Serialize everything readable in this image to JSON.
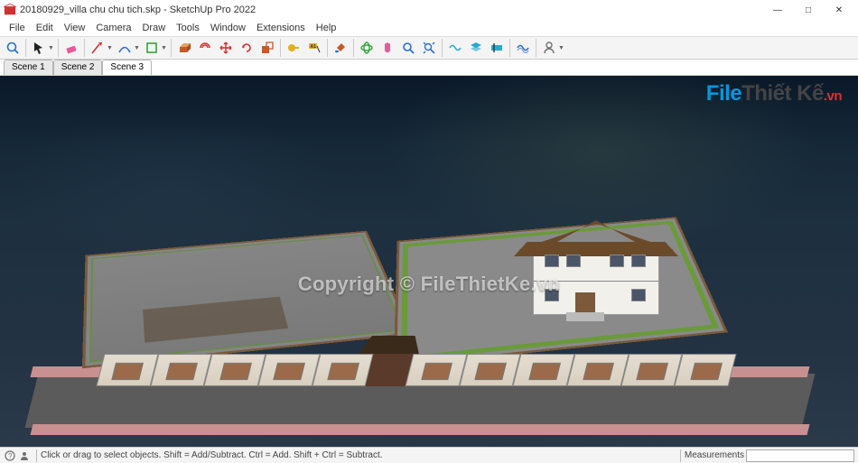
{
  "window": {
    "title": "20180929_villa chu chu tich.skp - SketchUp Pro 2022",
    "min": "—",
    "max": "□",
    "close": "✕"
  },
  "menu": {
    "items": [
      "File",
      "Edit",
      "View",
      "Camera",
      "Draw",
      "Tools",
      "Window",
      "Extensions",
      "Help"
    ]
  },
  "toolbar_icons": [
    "search",
    "select",
    "erase",
    "line",
    "arc",
    "shapes",
    "pushpull",
    "offset",
    "move",
    "rotate",
    "scale",
    "tape",
    "text",
    "paint",
    "orbit",
    "pan",
    "zoom",
    "zoom-extents",
    "section",
    "layers",
    "shadows",
    "styles",
    "3dwarehouse",
    "extwarehouse",
    "user"
  ],
  "scenes": {
    "tabs": [
      "Scene 1",
      "Scene 2",
      "Scene 3"
    ],
    "active": 2
  },
  "watermark": "Copyright © FileThietKe.vn",
  "brand": {
    "p1": "File",
    "p2": "Thiết Kế",
    "p3": ".vn"
  },
  "status": {
    "hint": "Click or drag to select objects. Shift = Add/Subtract. Ctrl = Add. Shift + Ctrl = Subtract.",
    "measurements_label": "Measurements",
    "measurements_value": ""
  },
  "colors": {
    "select_arrow": "#222",
    "red": "#d23030",
    "blue": "#2a70c8",
    "green": "#3aa040",
    "yellow": "#e0b020",
    "orange": "#e07820",
    "cyan": "#2aa8d0",
    "purple": "#7850c0",
    "gray": "#707070"
  }
}
